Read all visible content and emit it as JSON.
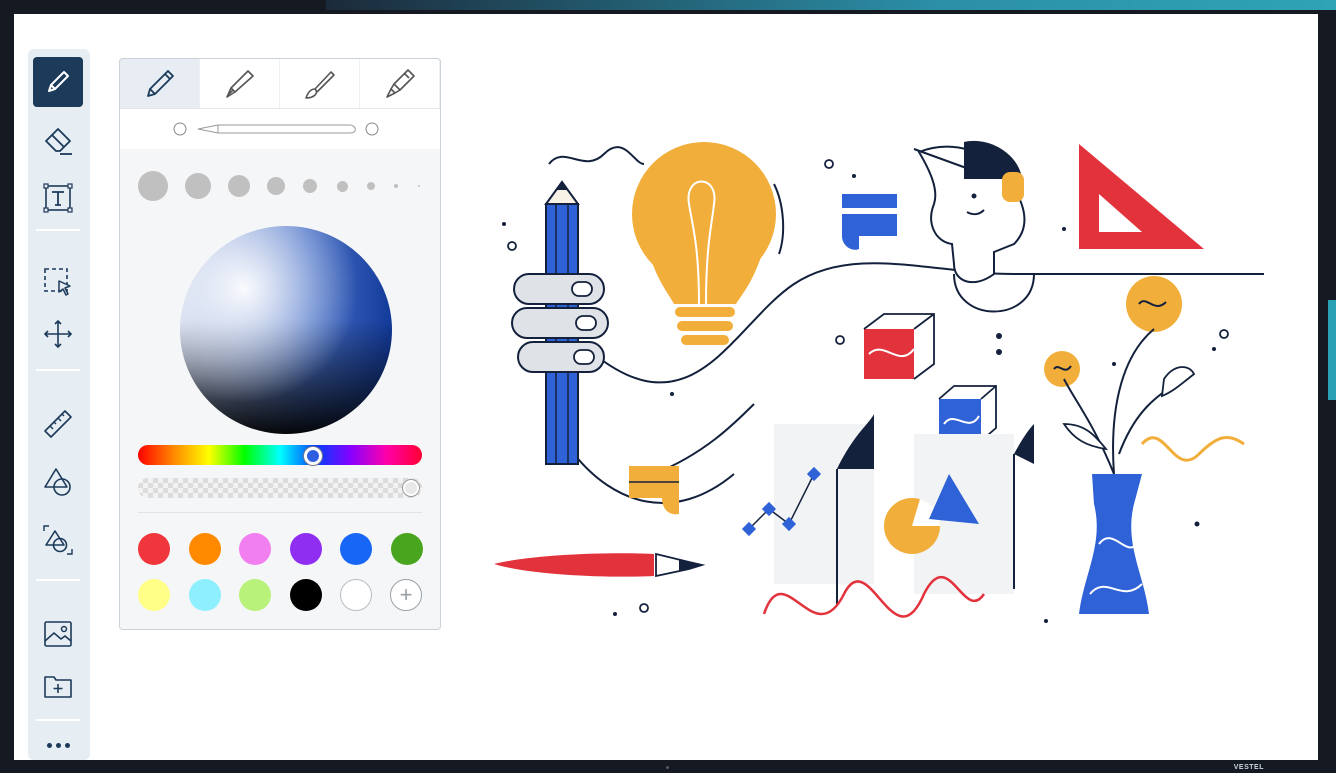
{
  "device": {
    "brand_label": "VESTEL"
  },
  "toolbar": {
    "tools": [
      {
        "name": "pen",
        "icon": "pen-icon",
        "active": true
      },
      {
        "name": "eraser",
        "icon": "eraser-icon"
      },
      {
        "name": "text",
        "icon": "text-box-icon"
      },
      {
        "name": "select",
        "icon": "lasso-select-icon"
      },
      {
        "name": "move",
        "icon": "move-arrows-icon"
      },
      {
        "name": "ruler",
        "icon": "ruler-icon"
      },
      {
        "name": "shapes",
        "icon": "shapes-icon"
      },
      {
        "name": "shape-recognition",
        "icon": "shape-recognize-icon"
      },
      {
        "name": "image",
        "icon": "image-icon"
      },
      {
        "name": "folder",
        "icon": "add-folder-icon"
      },
      {
        "name": "more",
        "icon": "more-dots-icon"
      }
    ]
  },
  "pen_panel": {
    "pen_types": [
      {
        "name": "pencil",
        "icon": "pencil-icon",
        "selected": true
      },
      {
        "name": "fountain-pen",
        "icon": "fountain-pen-icon"
      },
      {
        "name": "brush",
        "icon": "brush-icon"
      },
      {
        "name": "highlighter",
        "icon": "highlighter-icon"
      }
    ],
    "colors": {
      "row1": [
        "#f0353d",
        "#ff8a00",
        "#f27ff0",
        "#8f2ef0",
        "#1766f5",
        "#4aa51e"
      ],
      "row2": [
        "#ffff88",
        "#8ef0ff",
        "#b8f27a",
        "#000000",
        "#ffffff"
      ]
    },
    "selected_hue_color": "#2f5fe0",
    "add_color_symbol": "+"
  },
  "illustration": {
    "description_icon": "creative-tools-illustration"
  }
}
